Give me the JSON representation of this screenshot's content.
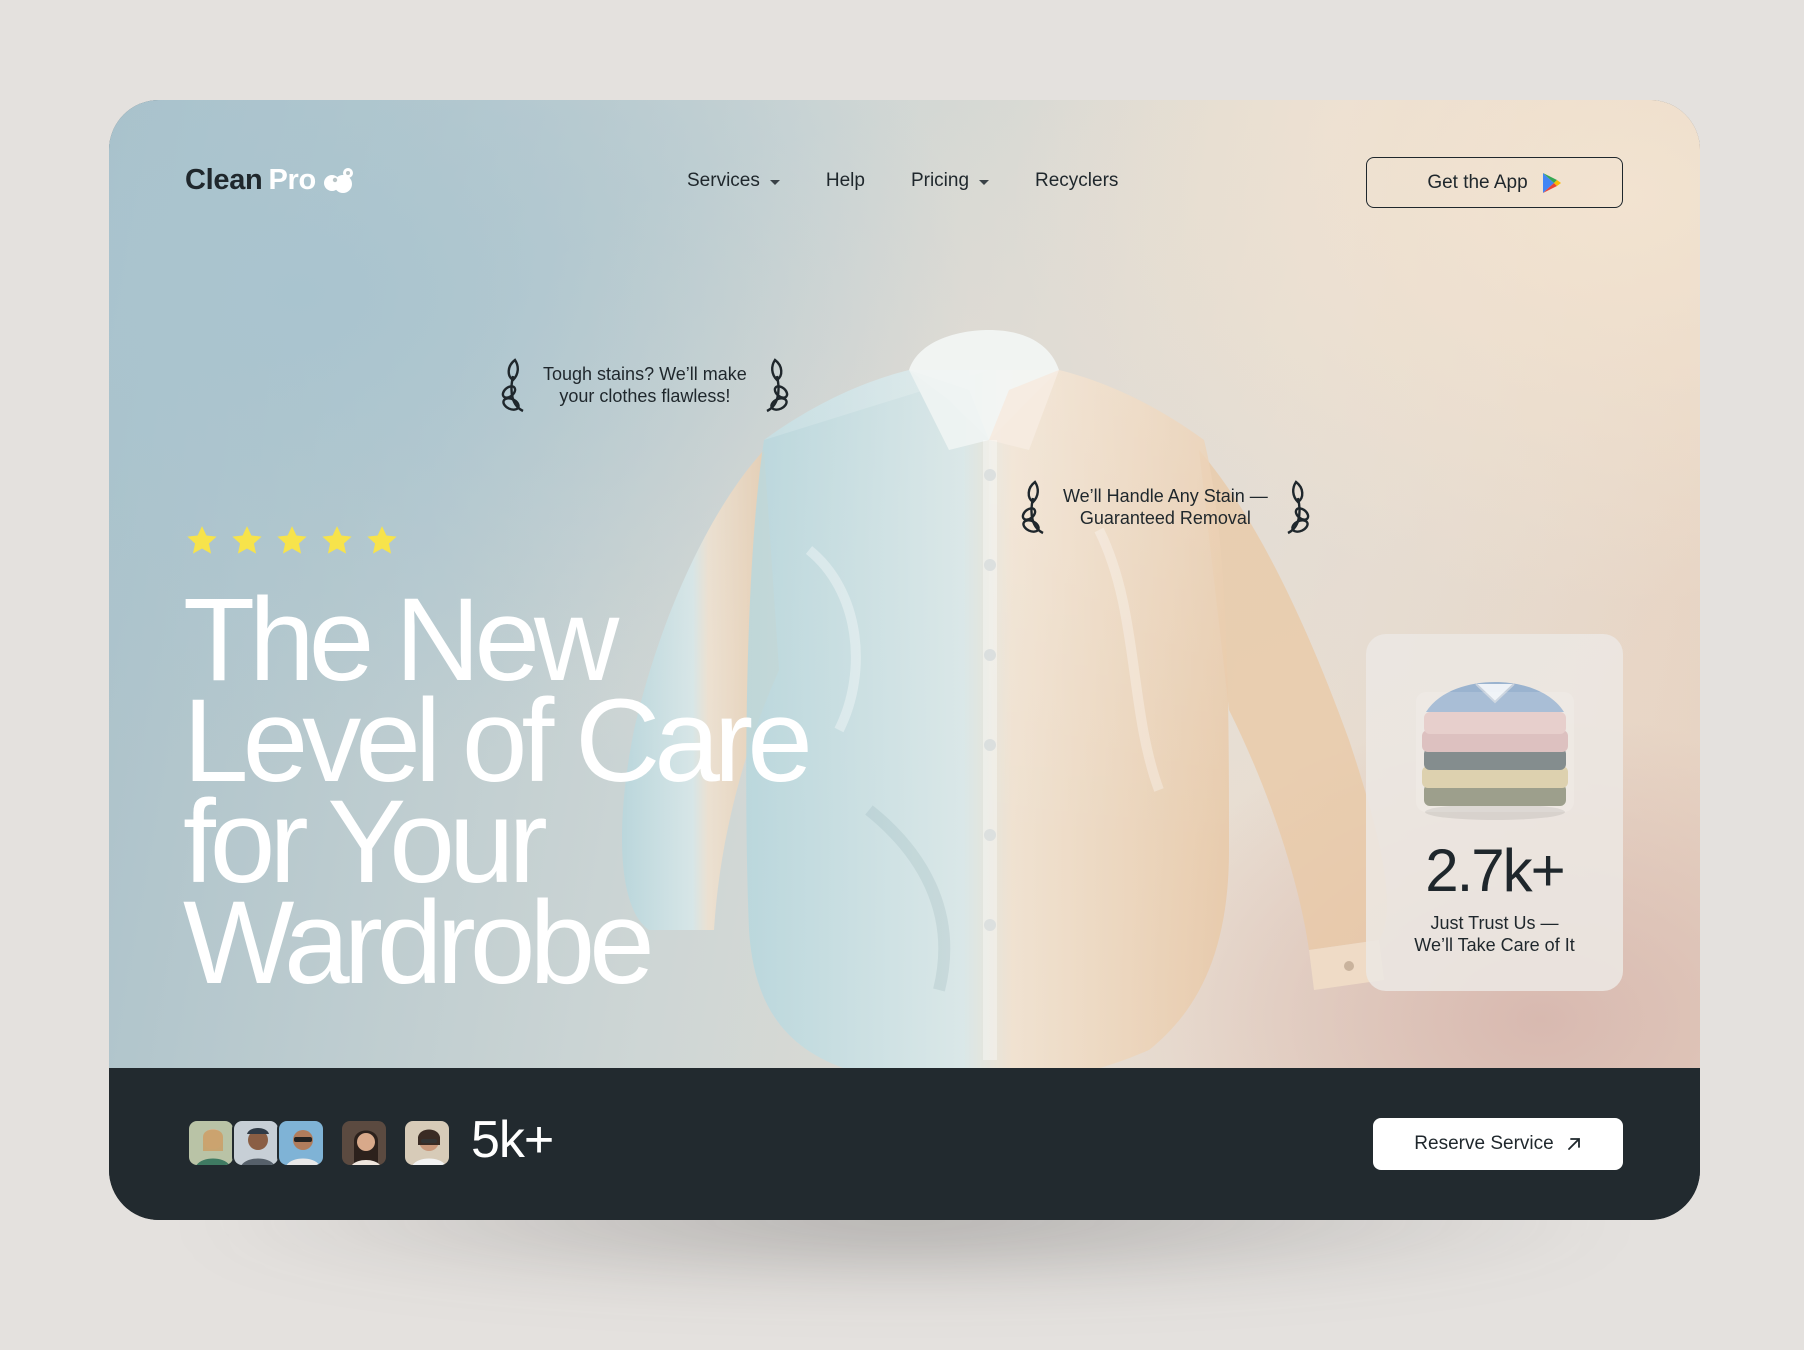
{
  "brand": {
    "name_part1": "Clean",
    "name_part2": "Pro",
    "logo_icon": "bubbles-icon"
  },
  "nav": {
    "items": [
      {
        "label": "Services",
        "has_dropdown": true
      },
      {
        "label": "Help",
        "has_dropdown": false
      },
      {
        "label": "Pricing",
        "has_dropdown": true
      },
      {
        "label": "Recyclers",
        "has_dropdown": false
      }
    ],
    "cta_label": "Get the App",
    "cta_icon": "google-play-icon"
  },
  "badges": [
    {
      "line1": "Tough stains? We’ll make",
      "line2": "your clothes flawless!"
    },
    {
      "line1": "We’ll Handle Any Stain —",
      "line2": "Guaranteed Removal"
    }
  ],
  "rating": {
    "stars": 5,
    "max": 5,
    "color": "#f7e34b"
  },
  "headline": {
    "line1": "The New",
    "line2": "Level of Care",
    "line3": "for Your",
    "line4": "Wardrobe"
  },
  "stats_card": {
    "number": "2.7k+",
    "caption_line1": "Just Trust Us —",
    "caption_line2": "We’ll Take Care of It"
  },
  "footer": {
    "customers_count": "5k+",
    "avatar_count": 5,
    "reserve_label": "Reserve Service",
    "reserve_icon": "arrow-up-right-icon"
  },
  "colors": {
    "dark": "#222a2f",
    "text": "#1f272c",
    "white": "#ffffff",
    "star": "#f7e34b"
  }
}
